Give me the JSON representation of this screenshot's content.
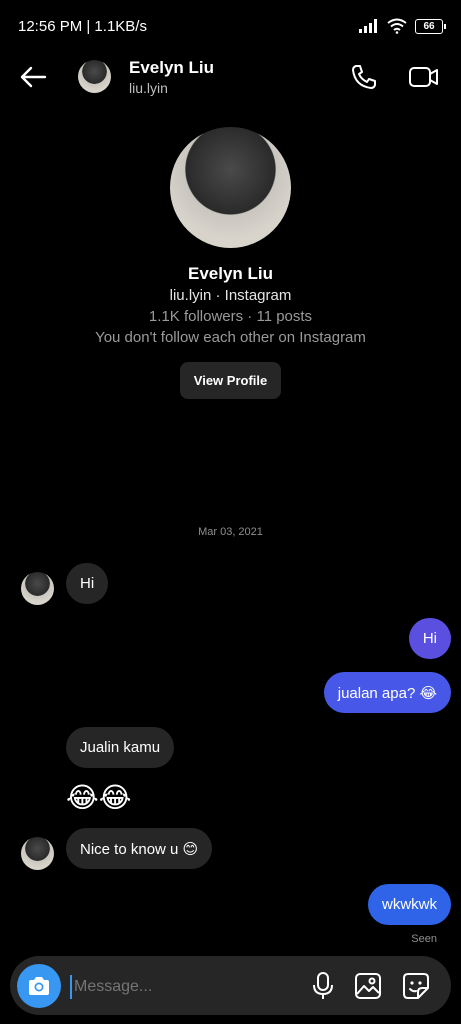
{
  "status_bar": {
    "time": "12:56 PM | 1.1KB/s",
    "battery": "66"
  },
  "header": {
    "name": "Evelyn Liu",
    "username": "liu.lyin"
  },
  "profile": {
    "name": "Evelyn Liu",
    "username_line": "liu.lyin · Instagram",
    "stats": "1.1K followers · 11 posts",
    "follow_status": "You don't follow each other on Instagram",
    "view_profile_label": "View Profile"
  },
  "date_divider": "Mar 03, 2021",
  "messages": [
    {
      "from": "them",
      "text": "Hi"
    },
    {
      "from": "me",
      "text": "Hi"
    },
    {
      "from": "me",
      "text": "jualan apa? 😂"
    },
    {
      "from": "them",
      "text": "Jualin kamu"
    },
    {
      "from": "them",
      "text": "😂😂"
    },
    {
      "from": "them",
      "text": "Nice to know u 😊"
    },
    {
      "from": "me",
      "text": "wkwkwk"
    }
  ],
  "seen_label": "Seen",
  "composer": {
    "placeholder": "Message..."
  },
  "colors": {
    "accent_blue": "#3897f0",
    "bubble_gray": "#262626",
    "bubble_purple": "#5b4fe0",
    "bubble_blue": "#2f63e8"
  }
}
